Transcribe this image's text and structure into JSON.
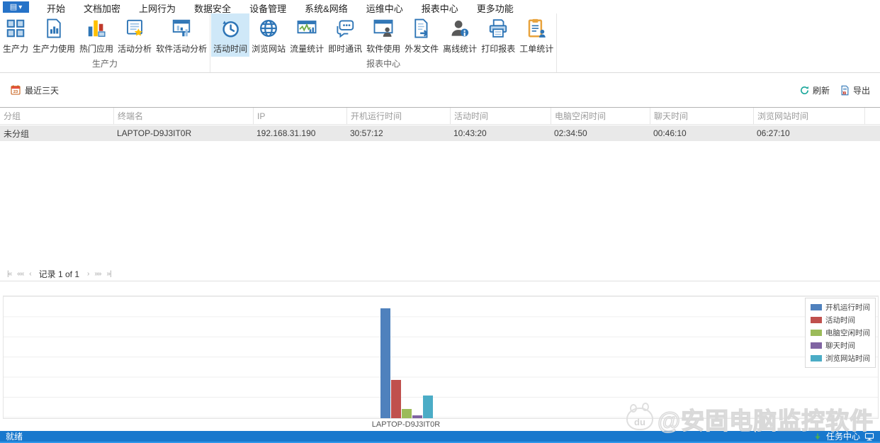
{
  "app": {
    "name": "安固电脑监控软件"
  },
  "colors": {
    "accent": "#2b7cd3",
    "ribbon_selected_bg": "#cfe8f8",
    "status_bar": "#1878cd",
    "row_selected_bg": "#e9e9e9"
  },
  "menubar": {
    "app_button": {
      "caret": "▾"
    },
    "tabs": [
      {
        "label": "开始"
      },
      {
        "label": "文档加密"
      },
      {
        "label": "上网行为"
      },
      {
        "label": "数据安全"
      },
      {
        "label": "设备管理"
      },
      {
        "label": "系统&网络"
      },
      {
        "label": "运维中心"
      },
      {
        "label": "报表中心",
        "active": true
      },
      {
        "label": "更多功能"
      }
    ]
  },
  "ribbon": {
    "groups": [
      {
        "label": "生产力",
        "items": [
          {
            "label": "生产力",
            "icon": "grid-icon"
          },
          {
            "label": "生产力使用",
            "icon": "document-chart-icon"
          },
          {
            "label": "热门应用",
            "icon": "colored-bars-icon"
          },
          {
            "label": "活动分析",
            "icon": "document-star-icon"
          },
          {
            "label": "软件活动分析",
            "icon": "window-chart-icon"
          }
        ]
      },
      {
        "label": "报表中心",
        "items": [
          {
            "label": "活动时间",
            "icon": "clock-history-icon",
            "selected": true
          },
          {
            "label": "浏览网站",
            "icon": "globe-icon"
          },
          {
            "label": "流量统计",
            "icon": "monitor-wave-icon"
          },
          {
            "label": "即时通讯",
            "icon": "chat-bubbles-icon"
          },
          {
            "label": "软件使用",
            "icon": "window-user-icon"
          },
          {
            "label": "外发文件",
            "icon": "document-arrow-icon"
          },
          {
            "label": "离线统计",
            "icon": "user-info-icon"
          },
          {
            "label": "打印报表",
            "icon": "printer-icon"
          },
          {
            "label": "工单统计",
            "icon": "clipboard-user-icon"
          }
        ]
      }
    ]
  },
  "toolbar": {
    "date_filter_label": "最近三天",
    "refresh_label": "刷新",
    "export_label": "导出"
  },
  "table": {
    "columns": [
      "分组",
      "终端名",
      "IP",
      "开机运行时间",
      "活动时间",
      "电脑空闲时间",
      "聊天时间",
      "浏览网站时间"
    ],
    "rows": [
      [
        "未分组",
        "LAPTOP-D9J3IT0R",
        "192.168.31.190",
        "30:57:12",
        "10:43:20",
        "02:34:50",
        "00:46:10",
        "06:27:10"
      ]
    ]
  },
  "pagination": {
    "label": "记录 1 of 1",
    "nav_first": "|«",
    "nav_prev_page": "««",
    "nav_prev": "‹",
    "nav_next": "›",
    "nav_next_page": "»»",
    "nav_last": "»|"
  },
  "chart_data": {
    "type": "bar",
    "categories": [
      "LAPTOP-D9J3IT0R"
    ],
    "series": [
      {
        "name": "开机运行时间",
        "color": "#4F81BD",
        "values_hms": [
          "30:57:12"
        ],
        "values_hours": [
          30.95
        ]
      },
      {
        "name": "活动时间",
        "color": "#C0504D",
        "values_hms": [
          "10:43:20"
        ],
        "values_hours": [
          10.72
        ]
      },
      {
        "name": "电脑空闲时间",
        "color": "#9BBB59",
        "values_hms": [
          "02:34:50"
        ],
        "values_hours": [
          2.58
        ]
      },
      {
        "name": "聊天时间",
        "color": "#8064A2",
        "values_hms": [
          "00:46:10"
        ],
        "values_hours": [
          0.77
        ]
      },
      {
        "name": "浏览网站时间",
        "color": "#4BACC6",
        "values_hms": [
          "06:27:10"
        ],
        "values_hours": [
          6.45
        ]
      }
    ],
    "title": "",
    "xlabel": "",
    "ylabel": "",
    "ylim": [
      0,
      34
    ],
    "grid": "horizontal",
    "legend_position": "top-right"
  },
  "watermark": {
    "badge_text": "du",
    "text": "@安固电脑监控软件"
  },
  "statusbar": {
    "left": "就绪",
    "task_center_label": "任务中心"
  }
}
